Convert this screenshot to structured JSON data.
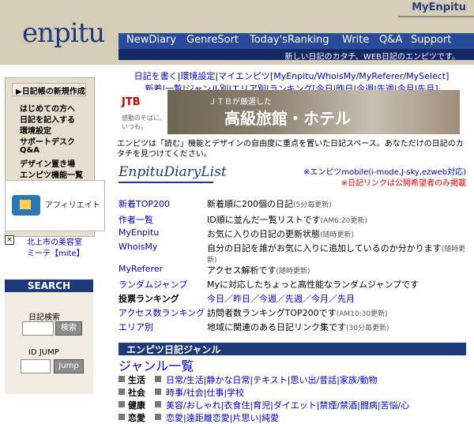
{
  "header": {
    "logo": "enpitu",
    "brand": "MyEnpitu",
    "tagline": "新しい日記のカタチ、WEB日記のエンピツです。",
    "nav": [
      "NewDiary",
      "GenreSort",
      "Today'sRanking",
      "Write",
      "Q&A",
      "Support"
    ]
  },
  "sidebar": {
    "menu_title": "▶日記帳の新規作成",
    "menu_items": [
      "はじめての方へ",
      "日記を記入する",
      "環境設定",
      "サポートデスク",
      "Q&A",
      "デザイン置き場",
      "エンピツ機能一覧"
    ],
    "affiliate_label": "アフィリエイト",
    "affiliate_link1": "北上市の美容室",
    "affiliate_link2": "ミーテ【mite】",
    "search_title": "SEARCH",
    "diary_search_label": "日記検索",
    "search_button": "検索",
    "id_jump_label": "ID JUMP",
    "jump_button": "Jump"
  },
  "toplinks": {
    "line1": [
      "日記を書く",
      "環境設定",
      "マイエンピツ",
      "[MyEnpitu",
      "WhoisMy",
      "MyReferer",
      "MySelect]"
    ],
    "line2": [
      "新着",
      "一覧",
      "ジャンル別",
      "エリア別",
      "ランキング",
      "[今日",
      "昨日",
      "今週",
      "先週",
      "今月",
      "先月]"
    ]
  },
  "banner": {
    "logo": "JTB",
    "subtitle": "感動のそばに、いつも。",
    "title_small": "ＪＴＢが厳選した",
    "title_big": "高級旅館・ホテル"
  },
  "description": "エンピツは「読む」機能とデザインの自由度に重点を置いた日記スペース。あなただけの日記のカタチを見つけてください。",
  "diary_list": {
    "title": "EnpituDiaryList",
    "note1": "※エンピツmobile(i-mode,J-sky,ezweb対応)",
    "note2": "※日記リンクは公開希望者のみ掲載",
    "rows": [
      {
        "label": "新着TOP200",
        "text": "新着順に200個の日記",
        "suffix": "(5分毎更新)"
      },
      {
        "label": "作者一覧",
        "text": "ID順に並んだ一覧リストです",
        "suffix": "(AM6:20更新)"
      },
      {
        "label": "MyEnpitu",
        "text": "お気に入りの日記の更新状態",
        "suffix": "(随時更新)"
      },
      {
        "label": "WhoisMy",
        "text": "自分の日記を誰がお気に入りに追加しているのか分かります",
        "suffix": "(随時更新)"
      },
      {
        "label": "MyReferer",
        "text": "アクセス解析です",
        "suffix": "(随時更新)"
      },
      {
        "label": "ランダムジャンプ",
        "text": "Myに対応したちょっと高性能なランダムジャンプです",
        "suffix": ""
      },
      {
        "label": "投票ランキング",
        "text": "今日／昨日／今週／先週／今月／先月",
        "suffix": ""
      },
      {
        "label": "アクセス数ランキング",
        "text": "訪問者数ランキングTOP200です",
        "suffix": "(AM10:30更新)"
      },
      {
        "label": "エリア別",
        "text": "地域に関連のある日記リンク集です",
        "suffix": "(30分毎更新)"
      }
    ]
  },
  "genre": {
    "bar_title": "エンピツ日記ジャンル",
    "title": "ジャンル一覧",
    "rows": [
      {
        "name": "生活",
        "links": "日常/生活|静かな日常|テキスト|思い出/昔話|家族/動物"
      },
      {
        "name": "社会",
        "links": "時事/社会|仕事|学校"
      },
      {
        "name": "健康",
        "links": "美容/おしゃれ|衣食住|育児|ダイエット|禁煙/禁酒|闘病|苦悩/心"
      },
      {
        "name": "恋愛",
        "links": "恋愛|遠距離恋愛|片思い|純愛"
      }
    ]
  }
}
